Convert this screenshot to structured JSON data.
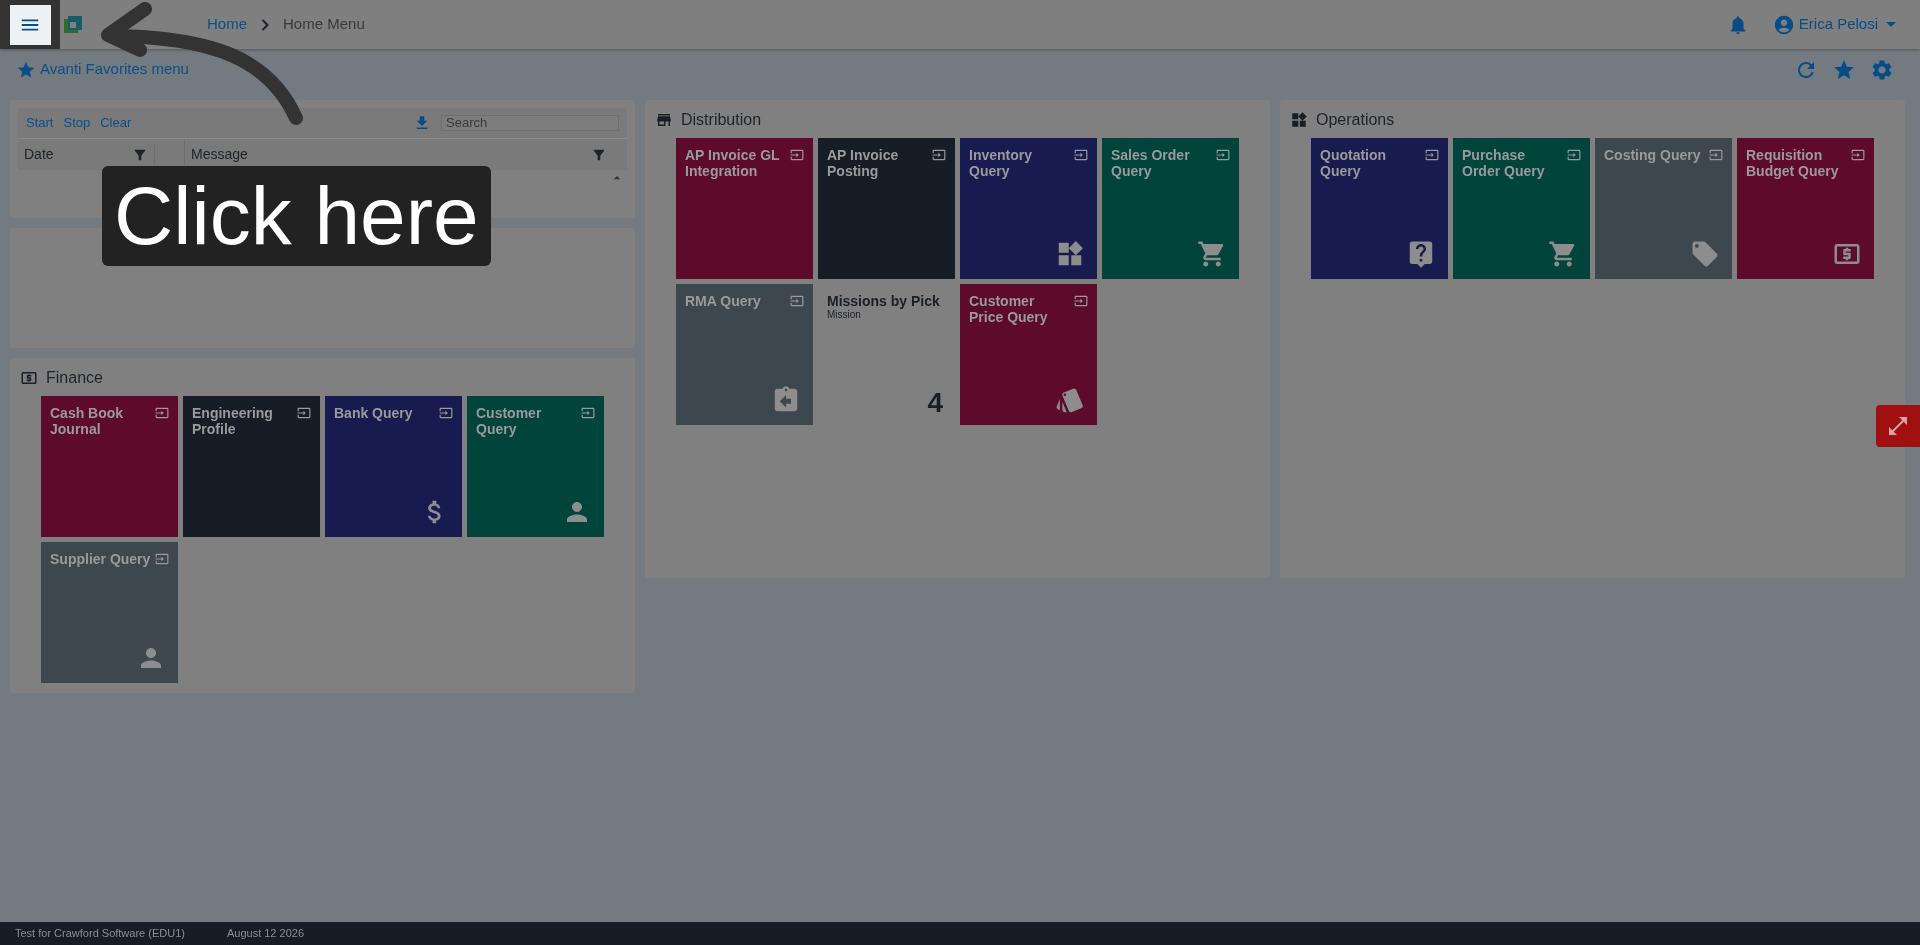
{
  "header": {
    "breadcrumbs": [
      {
        "label": "Home",
        "kind": "link"
      },
      {
        "label": "Home Menu",
        "kind": "current"
      }
    ],
    "user": "Erica Pelosi"
  },
  "favorites": {
    "label": "Avanti Favorites menu"
  },
  "log_panel": {
    "actions": [
      "Start",
      "Stop",
      "Clear"
    ],
    "search_placeholder": "Search",
    "columns": [
      "Date",
      "Message"
    ]
  },
  "sections": [
    {
      "title": "Finance",
      "tiles": [
        {
          "title": "Cash Book Journal",
          "kind": "link",
          "color": "#5e0a2b"
        },
        {
          "title": "Engineering Profile",
          "kind": "link",
          "color": "#161d26"
        },
        {
          "title": "Bank Query",
          "kind": "link",
          "color": "#171b4f"
        },
        {
          "title": "Customer Query",
          "kind": "link",
          "color": "#00443b"
        },
        {
          "title": "Supplier Query",
          "kind": "link",
          "color": "#3c474e"
        }
      ]
    },
    {
      "title": "Distribution",
      "tiles": [
        {
          "title": "AP Invoice GL Integration",
          "kind": "link",
          "color": "#5e0a2b"
        },
        {
          "title": "AP Invoice Posting",
          "kind": "link",
          "color": "#161d26"
        },
        {
          "title": "Inventory Query",
          "kind": "link",
          "color": "#171b4f"
        },
        {
          "title": "Sales Order Query",
          "kind": "link",
          "color": "#00443b"
        },
        {
          "title": "RMA Query",
          "kind": "link",
          "color": "#3c474e"
        },
        {
          "title": "Missions by Pick",
          "subtitle": "Mission",
          "count": "4",
          "kind": "counter"
        },
        {
          "title": "Customer Price Query",
          "kind": "link",
          "color": "#5e0a2b"
        }
      ]
    },
    {
      "title": "Operations",
      "tiles": [
        {
          "title": "Quotation Query",
          "kind": "link",
          "color": "#171b4f"
        },
        {
          "title": "Purchase Order Query",
          "kind": "link",
          "color": "#00443b"
        },
        {
          "title": "Costing Query",
          "kind": "link",
          "color": "#3c474e"
        },
        {
          "title": "Requisition Budget Query",
          "kind": "link",
          "color": "#5e0a2b"
        }
      ]
    }
  ],
  "footer": {
    "environment": "Test for Crawford Software (EDU1)",
    "date": "August 12 2026"
  },
  "callout": {
    "text": "Click here"
  }
}
